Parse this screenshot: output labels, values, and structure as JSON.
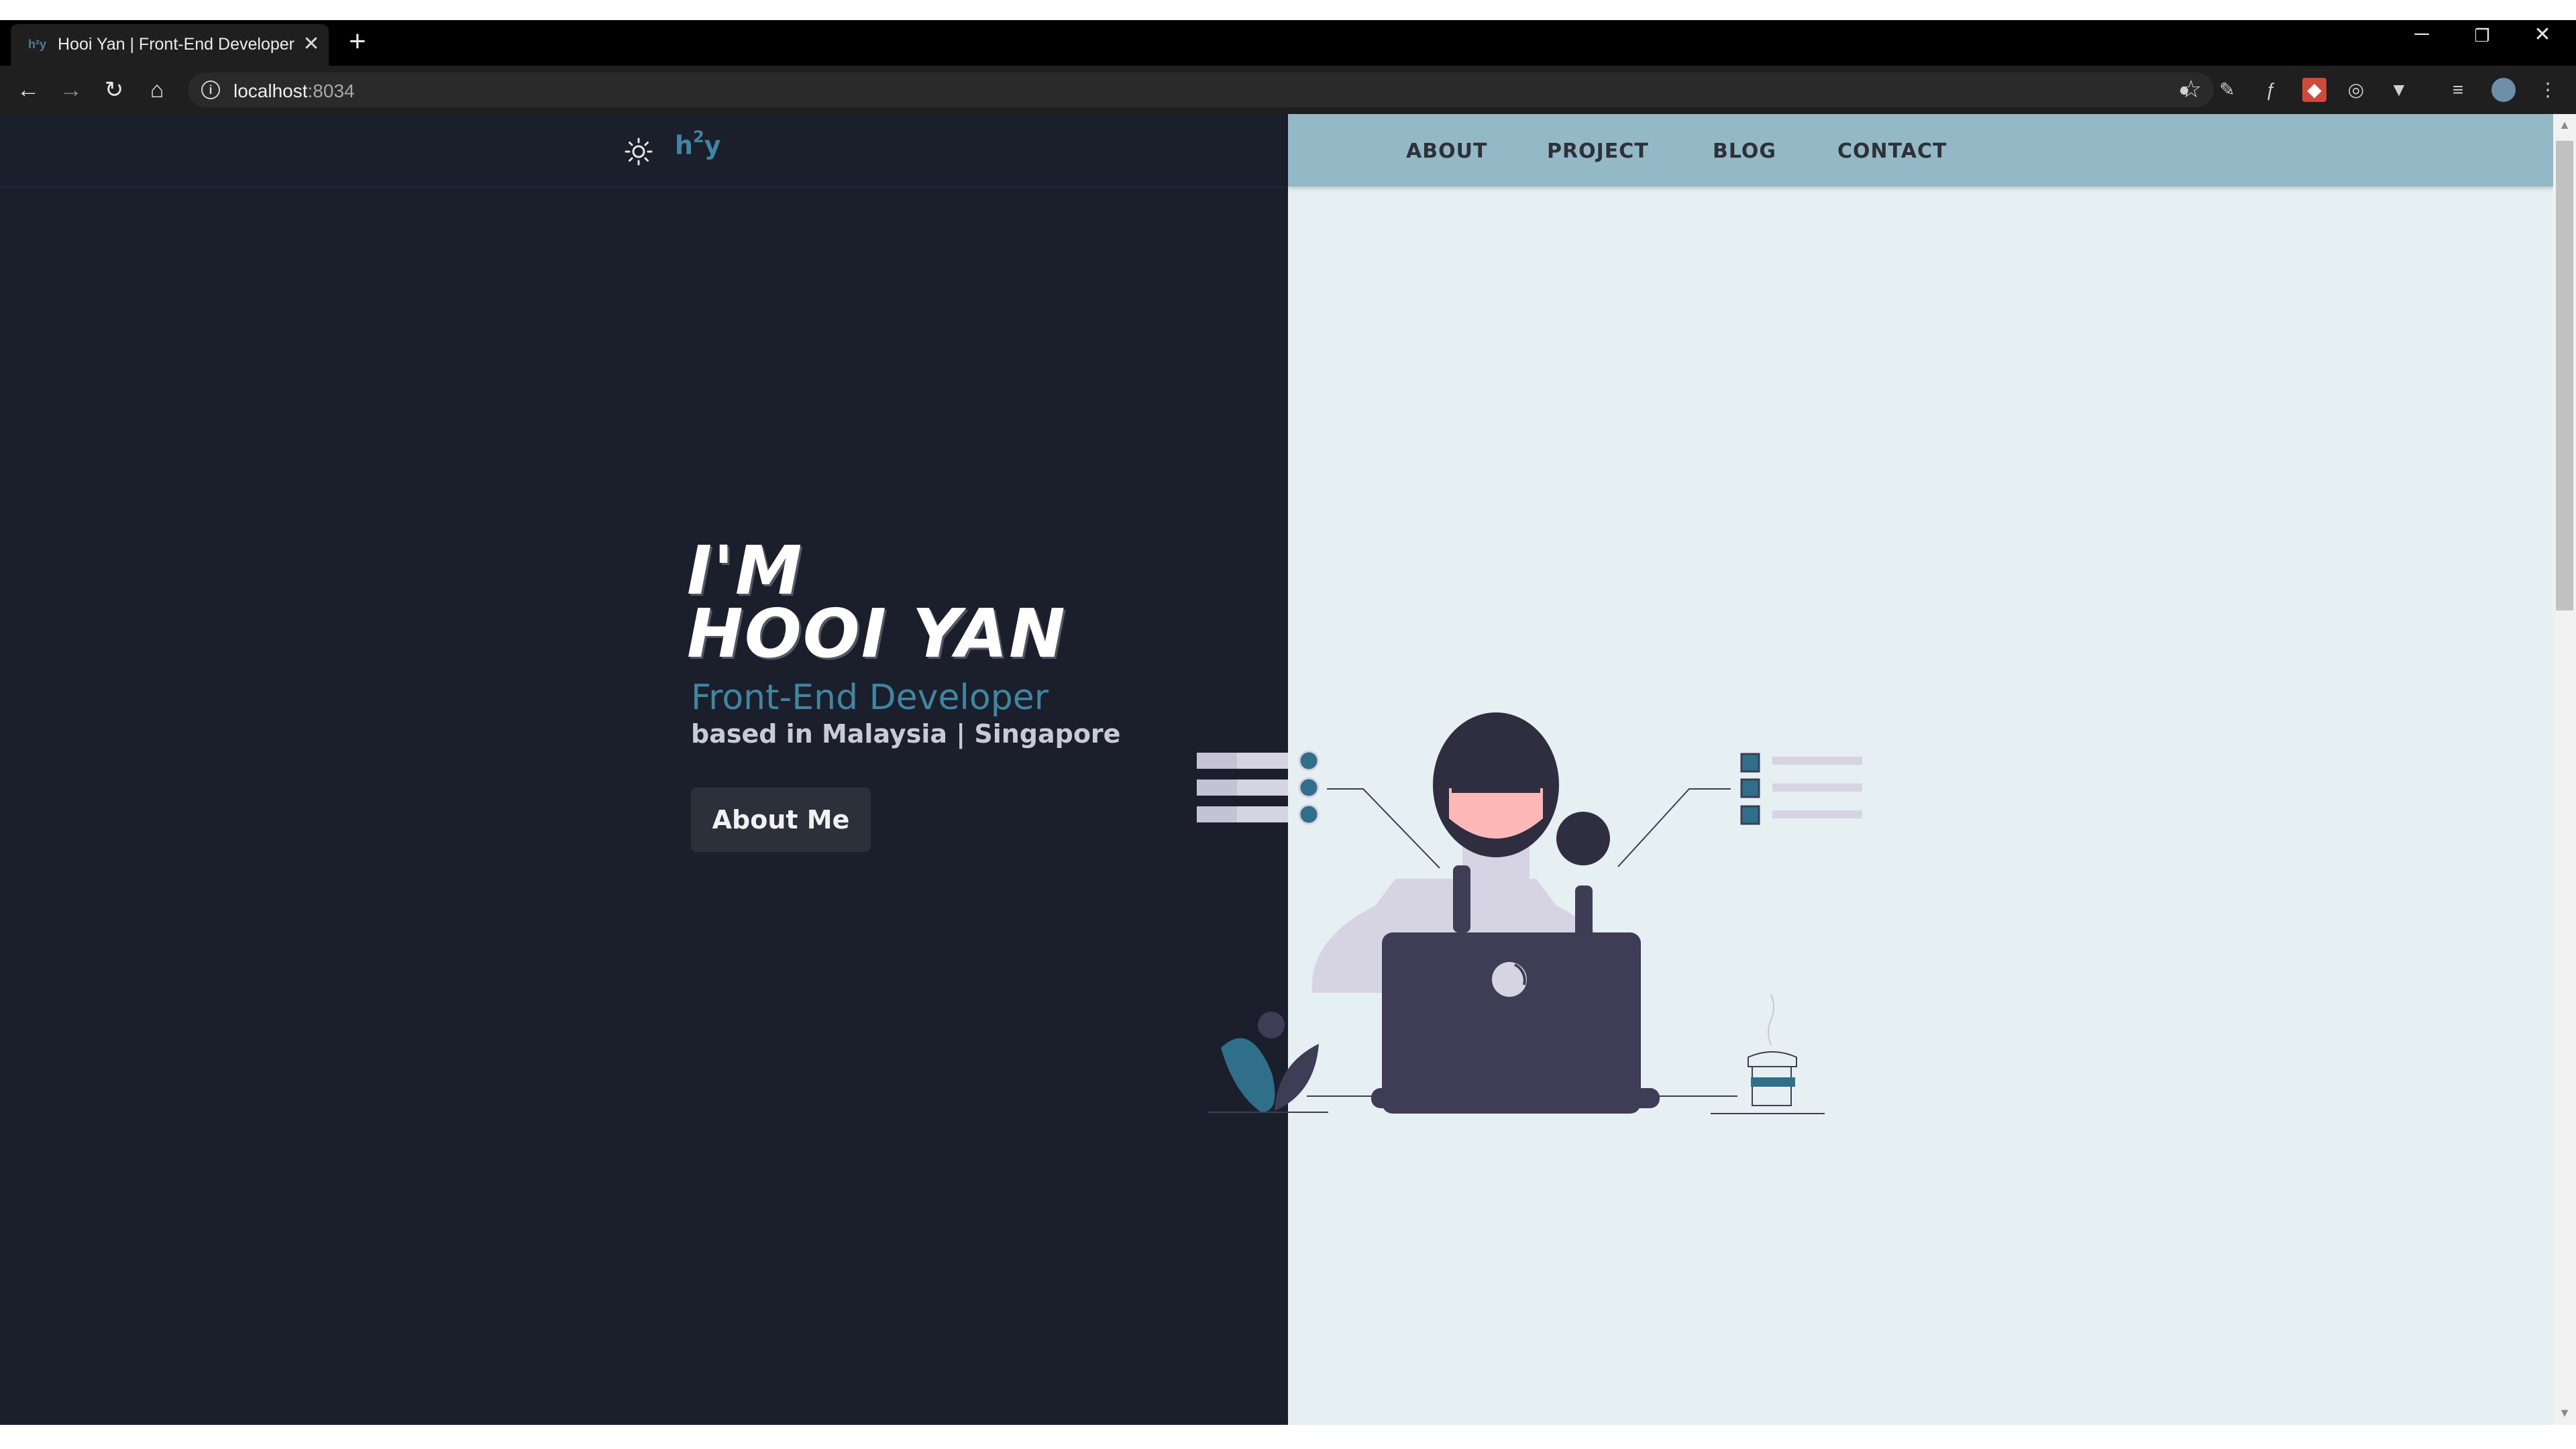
{
  "browser": {
    "tab_title": "Hooi Yan | Front-End Developer",
    "tab_favicon": "h²y",
    "url_host": "localhost",
    "url_port": ":8034",
    "icons": {
      "back": "back-arrow-icon",
      "forward": "forward-arrow-icon",
      "reload": "reload-icon",
      "home": "home-icon",
      "info": "info-icon",
      "bookmark": "star-icon",
      "menu": "kebab-menu-icon"
    }
  },
  "header": {
    "logo_main": "h",
    "logo_sup": "2",
    "logo_tail": "y",
    "nav": [
      "ABOUT",
      "PROJECT",
      "BLOG",
      "CONTACT"
    ]
  },
  "hero": {
    "line1": "I'M",
    "line2": "HOOI YAN",
    "role": "Front-End Developer",
    "location": "based in Malaysia | Singapore",
    "cta": "About Me"
  },
  "colors": {
    "dark_bg": "#1b1f2c",
    "light_bg": "#e6eff2",
    "nav_bg": "#93b9c7",
    "accent": "#3f86a3",
    "illustration_purple": "#3f3d56"
  }
}
